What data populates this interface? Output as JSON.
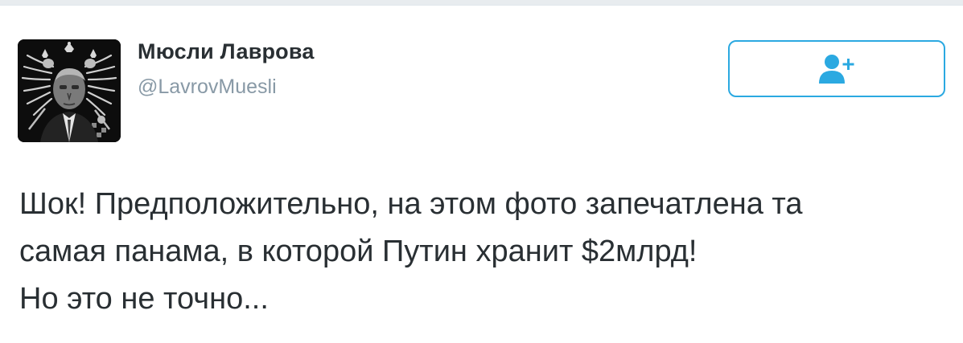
{
  "author": {
    "display_name": "Мюсли Лаврова",
    "handle": "@LavrovMuesli",
    "avatar_icon": "portrait-with-double-headed-eagle"
  },
  "follow_button": {
    "icon": "add-user-icon",
    "color": "#2ba9e1"
  },
  "tweet": {
    "lines": [
      "Шок! Предположительно, на этом фото запечатлена та",
      "самая панама, в которой Путин хранит $2млрд!",
      "Но это не точно..."
    ]
  },
  "colors": {
    "text": "#292f33",
    "secondary_text": "#8899a6",
    "accent": "#2ba9e1",
    "background": "#ffffff"
  }
}
